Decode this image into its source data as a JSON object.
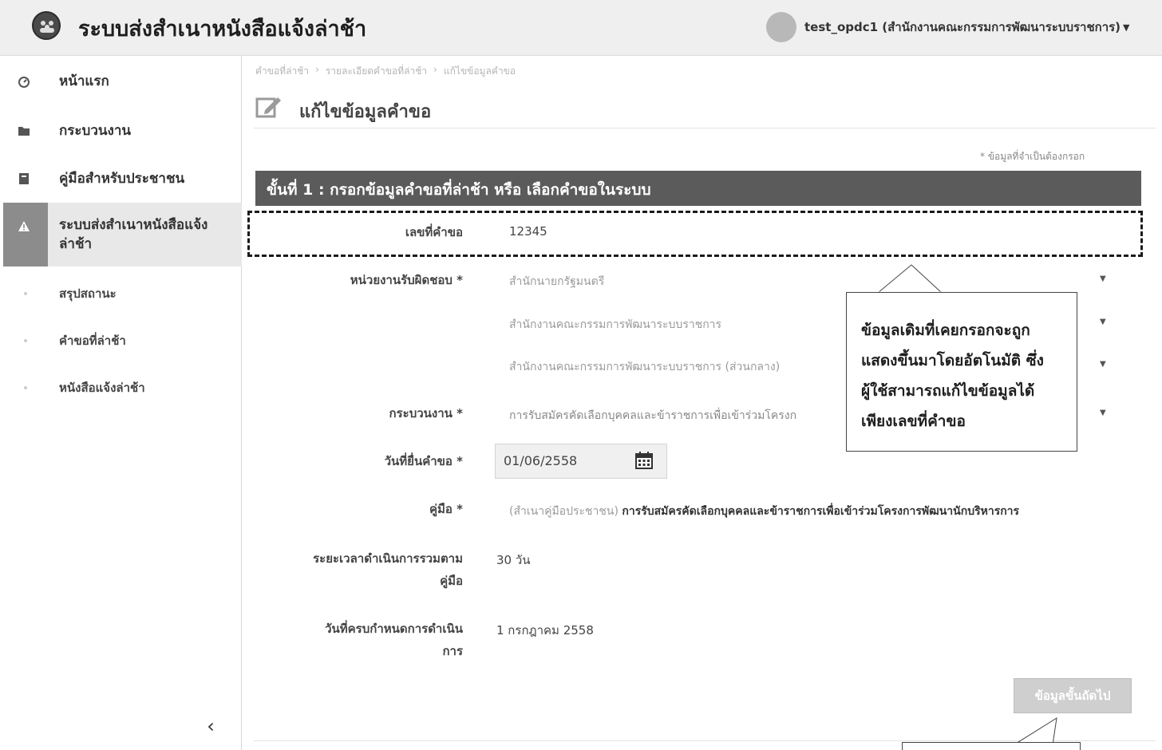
{
  "header": {
    "app_title": "ระบบส่งสำเนาหนังสือแจ้งล่าช้า",
    "user": "test_opdc1 (สำนักงานคณะกรรมการพัฒนาระบบราชการ)"
  },
  "sidebar": {
    "items": [
      {
        "label": "หน้าแรก",
        "icon": "dashboard-icon"
      },
      {
        "label": "กระบวนงาน",
        "icon": "folder-icon"
      },
      {
        "label": "คู่มือสำหรับประชาชน",
        "icon": "book-icon"
      },
      {
        "label": "ระบบส่งสำเนาหนังสือแจ้งล่าช้า",
        "icon": "warning-icon",
        "active": true
      }
    ],
    "sub_items": [
      "สรุปสถานะ",
      "คำขอที่ล่าช้า",
      "หนังสือแจ้งล่าช้า"
    ]
  },
  "breadcrumb": [
    "คำขอที่ล่าช้า",
    "รายละเอียดคำขอที่ล่าช้า",
    "แก้ไขข้อมูลคำขอ"
  ],
  "page": {
    "title": "แก้ไขข้อมูลคำขอ",
    "required_note": "* ข้อมูลที่จำเป็นต้องกรอก",
    "step_title": "ขั้นที่ 1 : กรอกข้อมูลคำขอที่ล่าช้า หรือ เลือกคำขอในระบบ"
  },
  "form": {
    "request_no": {
      "label": "เลขที่คำขอ",
      "value": "12345"
    },
    "agency": {
      "label": "หน่วยงานรับผิดชอบ *",
      "level1": "สำนักนายกรัฐมนตรี",
      "level2": "สำนักงานคณะกรรมการพัฒนาระบบราชการ",
      "level3": "สำนักงานคณะกรรมการพัฒนาระบบราชการ (ส่วนกลาง)"
    },
    "process": {
      "label": "กระบวนงาน *",
      "value": "การรับสมัครคัดเลือกบุคคลและข้าราชการเพื่อเข้าร่วมโครงก"
    },
    "submit_date": {
      "label": "วันที่ยื่นคำขอ *",
      "value": "01/06/2558"
    },
    "manual": {
      "label": "คู่มือ *",
      "prefix": "(สำเนาคู่มือประชาชน)",
      "value": "การรับสมัครคัดเลือกบุคคลและข้าราชการเพื่อเข้าร่วมโครงการพัฒนานักบริหารการ"
    },
    "duration": {
      "label_line1": "ระยะเวลาดำเนินการรวมตาม",
      "label_line2": "คู่มือ",
      "value": "30 วัน"
    },
    "deadline": {
      "label_line1": "วันที่ครบกำหนดการดำเนิน",
      "label_line2": "การ",
      "value": "1 กรกฎาคม 2558"
    },
    "next_button": "ข้อมูลขั้นถัดไป"
  },
  "callout": {
    "lines": [
      "ข้อมูลเดิมที่เคยกรอกจะถูก",
      "แสดงขึ้นมาโดยอัตโนมัติ ซึ่ง",
      "ผู้ใช้สามารถแก้ไขข้อมูลได้",
      "เพียงเลขที่คำขอ"
    ]
  },
  "colors": {
    "step_bar": "#5b5b5b",
    "active_tab": "#8c8c8c"
  }
}
